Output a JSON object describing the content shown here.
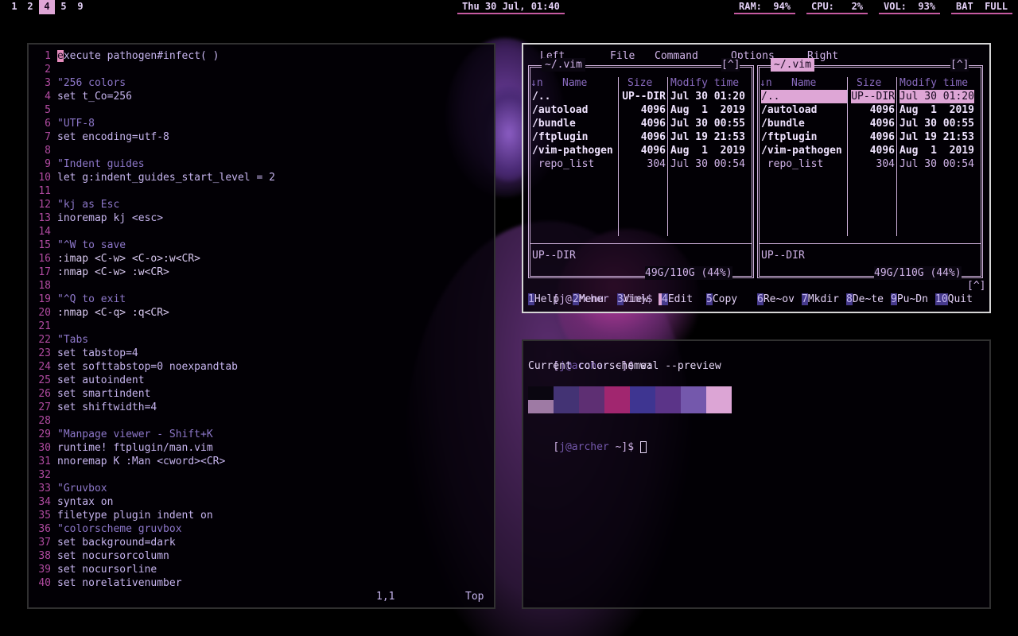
{
  "bar": {
    "workspaces": [
      "1",
      "2",
      "4",
      "5",
      "9"
    ],
    "active_workspace": "4",
    "clock": "Thu 30 Jul, 01:40",
    "ram": "RAM:  94%",
    "cpu": "CPU:   2%",
    "vol": "VOL:  93%",
    "bat": "BAT  FULL",
    "accent_color": "#c65aa1"
  },
  "vim": {
    "lines": [
      "execute pathogen#infect( )",
      "",
      "\"256 colors",
      "set t_Co=256",
      "",
      "\"UTF-8",
      "set encoding=utf-8",
      "",
      "\"Indent guides",
      "let g:indent_guides_start_level = 2",
      "",
      "\"kj as Esc",
      "inoremap kj <esc>",
      "",
      "\"^W to save",
      ":imap <C-w> <C-o>:w<CR>",
      ":nmap <C-w> :w<CR>",
      "",
      "\"^Q to exit",
      ":nmap <C-q> :q<CR>",
      "",
      "\"Tabs",
      "set tabstop=4",
      "set softtabstop=0 noexpandtab",
      "set autoindent",
      "set smartindent",
      "set shiftwidth=4",
      "",
      "\"Manpage viewer - Shift+K",
      "runtime! ftplugin/man.vim",
      "nnoremap K :Man <cword><CR>",
      "",
      "\"Gruvbox",
      "syntax on",
      "filetype plugin indent on",
      "\"colorscheme gruvbox",
      "set background=dark",
      "set nocursorcolumn",
      "set nocursorline",
      "set norelativenumber"
    ],
    "ruler_position": "1,1",
    "ruler_scroll": "Top"
  },
  "mc": {
    "menu": [
      "Left",
      "File",
      "Command",
      "Options",
      "Right"
    ],
    "left_path": "~/.vim",
    "right_path": "~/.vim",
    "history_marker": "[^]",
    "columns": [
      "↓n",
      "Name",
      "Size",
      "Modify time"
    ],
    "rows": [
      {
        "name": "/..",
        "size": "UP--DIR",
        "time": "Jul 30 01:20",
        "dir": true
      },
      {
        "name": "/autoload",
        "size": "4096",
        "time": "Aug  1  2019",
        "dir": true
      },
      {
        "name": "/bundle",
        "size": "4096",
        "time": "Jul 30 00:55",
        "dir": true
      },
      {
        "name": "/ftplugin",
        "size": "4096",
        "time": "Jul 19 21:53",
        "dir": true
      },
      {
        "name": "/vim-pathogen",
        "size": "4096",
        "time": "Aug  1  2019",
        "dir": true
      },
      {
        "name": " repo_list",
        "size": "304",
        "time": "Jul 30 00:54",
        "dir": false
      }
    ],
    "mini_status": "UP--DIR",
    "disk": "49G/110G (44%)",
    "prompt": "[j@archer .vim]$",
    "fkeys": [
      {
        "num": "1",
        "label": "Help"
      },
      {
        "num": "2",
        "label": "Menu"
      },
      {
        "num": "3",
        "label": "View"
      },
      {
        "num": "4",
        "label": "Edit"
      },
      {
        "num": "5",
        "label": "Copy"
      },
      {
        "num": "6",
        "label": "Re~ov"
      },
      {
        "num": "7",
        "label": "Mkdir"
      },
      {
        "num": "8",
        "label": "De~te"
      },
      {
        "num": "9",
        "label": "Pu~Dn"
      },
      {
        "num": "10",
        "label": "Quit"
      }
    ]
  },
  "term": {
    "prompt1_user": "j@archer",
    "prompt1_dir": "~",
    "command": "wal --preview",
    "output": "Current colorscheme:",
    "prompt2_user": "j@archer",
    "prompt2_dir": "~",
    "palette_top": [
      "#0a0610",
      "#433374",
      "#5e2f73",
      "#a1266f",
      "#3e3591",
      "#5b3488",
      "#7458ac",
      "#dca5d5"
    ],
    "palette_bottom_left": "#9e7aa4"
  }
}
